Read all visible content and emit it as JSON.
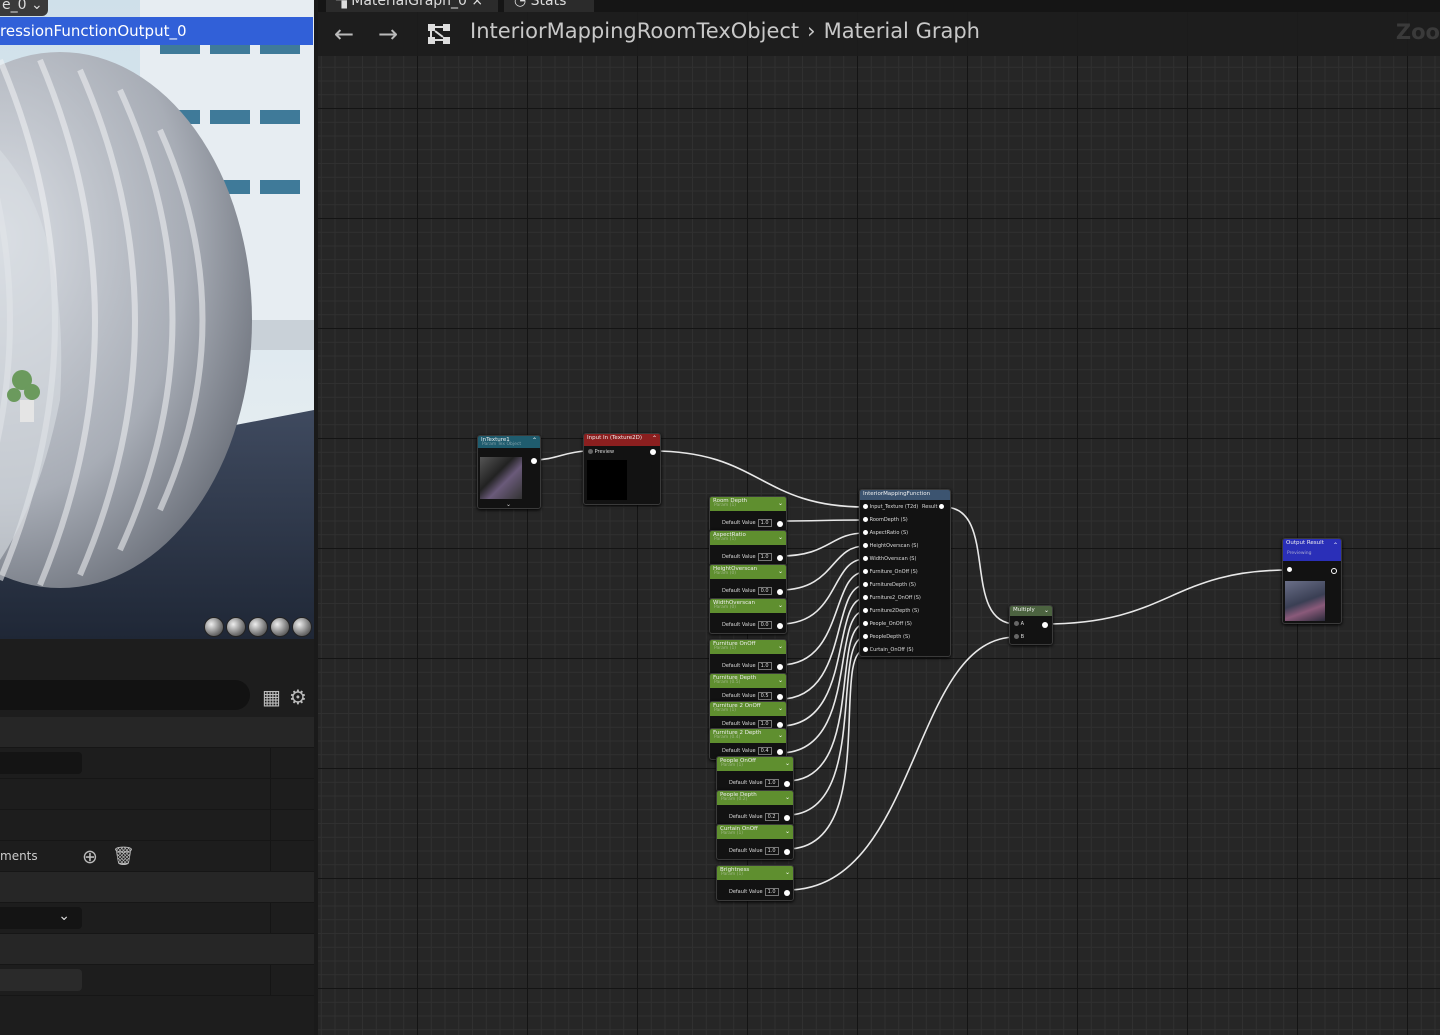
{
  "viewport": {
    "combo_label": "e_0",
    "title": "ressionFunctionOutput_0"
  },
  "details": {
    "section_label": "ments"
  },
  "tabs": [
    {
      "label": "MaterialGraph_0",
      "close": "×"
    },
    {
      "label": "Stats"
    }
  ],
  "toolbar": {
    "breadcrumb": [
      "InteriorMappingRoomTexObject",
      "Material Graph"
    ],
    "separator": "›",
    "zoom_label": "Zoo"
  },
  "nodes": {
    "intexture": {
      "title": "InTexture1",
      "subtitle": "Param Tex Object"
    },
    "input_in": {
      "title": "Input In (Texture2D)",
      "pin": "Preview"
    },
    "function": {
      "title": "InteriorMappingFunction",
      "result": "Result",
      "inputs": [
        "Input_Texture (T2d)",
        "RoomDepth (S)",
        "AspectRatio (S)",
        "HeightOverscan (S)",
        "WidthOverscan (S)",
        "Furniture_OnOff (S)",
        "FurnitureDepth (S)",
        "Furniture2_OnOff (S)",
        "Furniture2Depth (S)",
        "People_OnOff (S)",
        "PeopleDepth (S)",
        "Curtain_OnOff (S)"
      ]
    },
    "multiply": {
      "title": "Multiply",
      "a": "A",
      "b": "B"
    },
    "output": {
      "title": "Output Result",
      "subtitle": "Previewing"
    },
    "params": [
      {
        "title": "Room Depth",
        "subtitle": "Param (1)",
        "label": "Default Value",
        "value": "1.0"
      },
      {
        "title": "AspectRatio",
        "subtitle": "Param (1)",
        "label": "Default Value",
        "value": "1.0"
      },
      {
        "title": "HeightOverscan",
        "subtitle": "Param (0)",
        "label": "Default Value",
        "value": "0.0"
      },
      {
        "title": "WidthOverscan",
        "subtitle": "Param (0)",
        "label": "Default Value",
        "value": "0.0"
      },
      {
        "title": "Furniture OnOff",
        "subtitle": "Param (1)",
        "label": "Default Value",
        "value": "1.0"
      },
      {
        "title": "Furniture Depth",
        "subtitle": "Param (0.5)",
        "label": "Default Value",
        "value": "0.5"
      },
      {
        "title": "Furniture 2 OnOff",
        "subtitle": "Param (1)",
        "label": "Default Value",
        "value": "1.0"
      },
      {
        "title": "Furniture 2 Depth",
        "subtitle": "Param (0.4)",
        "label": "Default Value",
        "value": "0.4"
      },
      {
        "title": "People OnOff",
        "subtitle": "Param (1)",
        "label": "Default Value",
        "value": "1.0"
      },
      {
        "title": "People Depth",
        "subtitle": "Param (0.2)",
        "label": "Default Value",
        "value": "0.2"
      },
      {
        "title": "Curtain OnOff",
        "subtitle": "Param (1)",
        "label": "Default Value",
        "value": "1.0"
      },
      {
        "title": "Brightness",
        "subtitle": "Param (1)",
        "label": "Default Value",
        "value": "1.0"
      }
    ]
  },
  "colors": {
    "accent_blue": "#3160d8",
    "param_green": "#5f8f2f",
    "texture_teal": "#1f5c6e",
    "input_red": "#8b1f1f",
    "function_blue": "#3c5470",
    "multiply_green": "#4c6340",
    "output_blue": "#2a2fb8"
  }
}
